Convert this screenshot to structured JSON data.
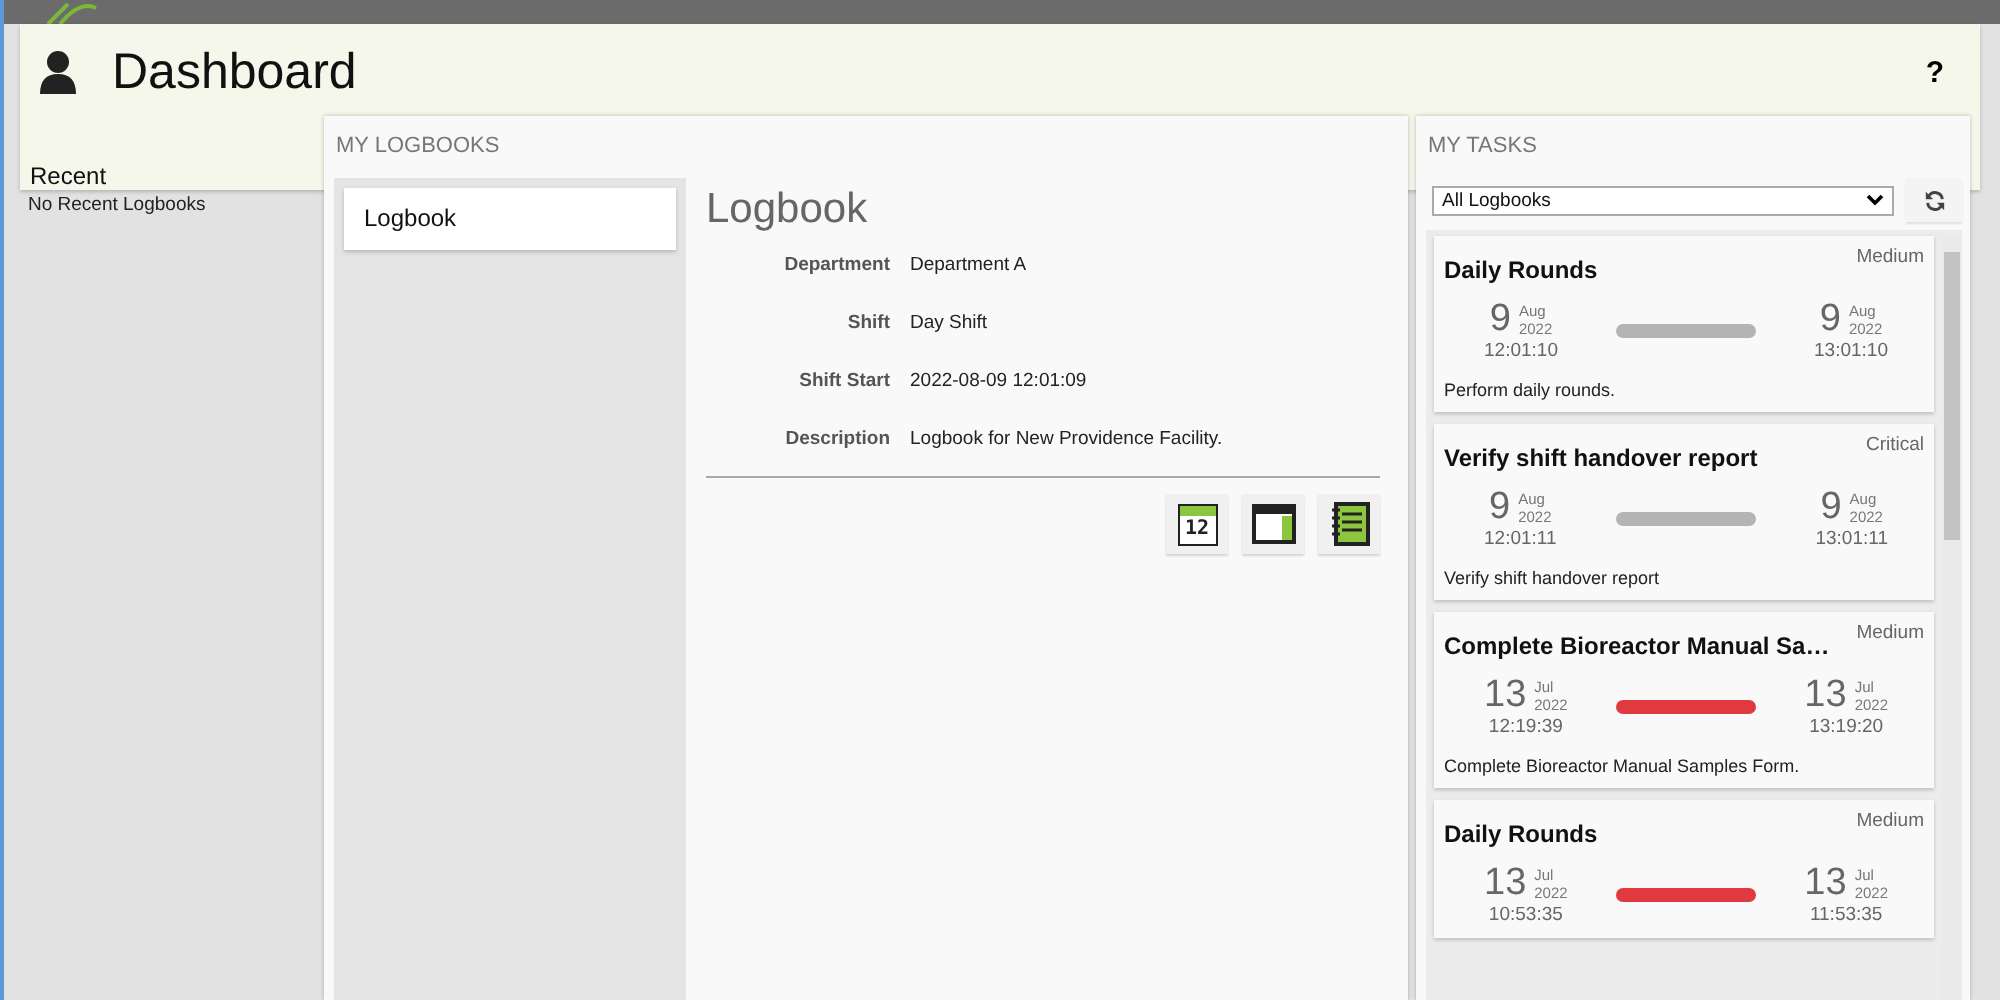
{
  "header": {
    "title": "Dashboard",
    "help": "?"
  },
  "recent": {
    "title": "Recent",
    "empty": "No Recent Logbooks"
  },
  "logbooks": {
    "title": "MY LOGBOOKS",
    "items": [
      {
        "label": "Logbook",
        "selected": true
      }
    ],
    "detail": {
      "title": "Logbook",
      "fields": [
        {
          "label": "Department",
          "value": "Department A"
        },
        {
          "label": "Shift",
          "value": "Day Shift"
        },
        {
          "label": "Shift Start",
          "value": "2022-08-09 12:01:09"
        },
        {
          "label": "Description",
          "value": "Logbook for New Providence Facility."
        }
      ],
      "actions": [
        {
          "kind": "calendar",
          "day": "12"
        },
        {
          "kind": "layout"
        },
        {
          "kind": "notebook"
        }
      ]
    }
  },
  "tasks": {
    "title": "MY TASKS",
    "filter": "All Logbooks",
    "items": [
      {
        "title": "Daily Rounds",
        "priority": "Medium",
        "color": "#b4b4b4",
        "start": {
          "day": "9",
          "month": "Aug",
          "year": "2022",
          "time": "12:01:10"
        },
        "end": {
          "day": "9",
          "month": "Aug",
          "year": "2022",
          "time": "13:01:10"
        },
        "description": "Perform daily rounds."
      },
      {
        "title": "Verify shift handover report",
        "priority": "Critical",
        "color": "#b4b4b4",
        "start": {
          "day": "9",
          "month": "Aug",
          "year": "2022",
          "time": "12:01:11"
        },
        "end": {
          "day": "9",
          "month": "Aug",
          "year": "2022",
          "time": "13:01:11"
        },
        "description": "Verify shift handover report"
      },
      {
        "title": "Complete Bioreactor Manual Sa…",
        "priority": "Medium",
        "color": "#e0393f",
        "start": {
          "day": "13",
          "month": "Jul",
          "year": "2022",
          "time": "12:19:39"
        },
        "end": {
          "day": "13",
          "month": "Jul",
          "year": "2022",
          "time": "13:19:20"
        },
        "description": "Complete Bioreactor Manual Samples Form."
      },
      {
        "title": "Daily Rounds",
        "priority": "Medium",
        "color": "#e0393f",
        "start": {
          "day": "13",
          "month": "Jul",
          "year": "2022",
          "time": "10:53:35"
        },
        "end": {
          "day": "13",
          "month": "Jul",
          "year": "2022",
          "time": "11:53:35"
        }
      }
    ]
  }
}
